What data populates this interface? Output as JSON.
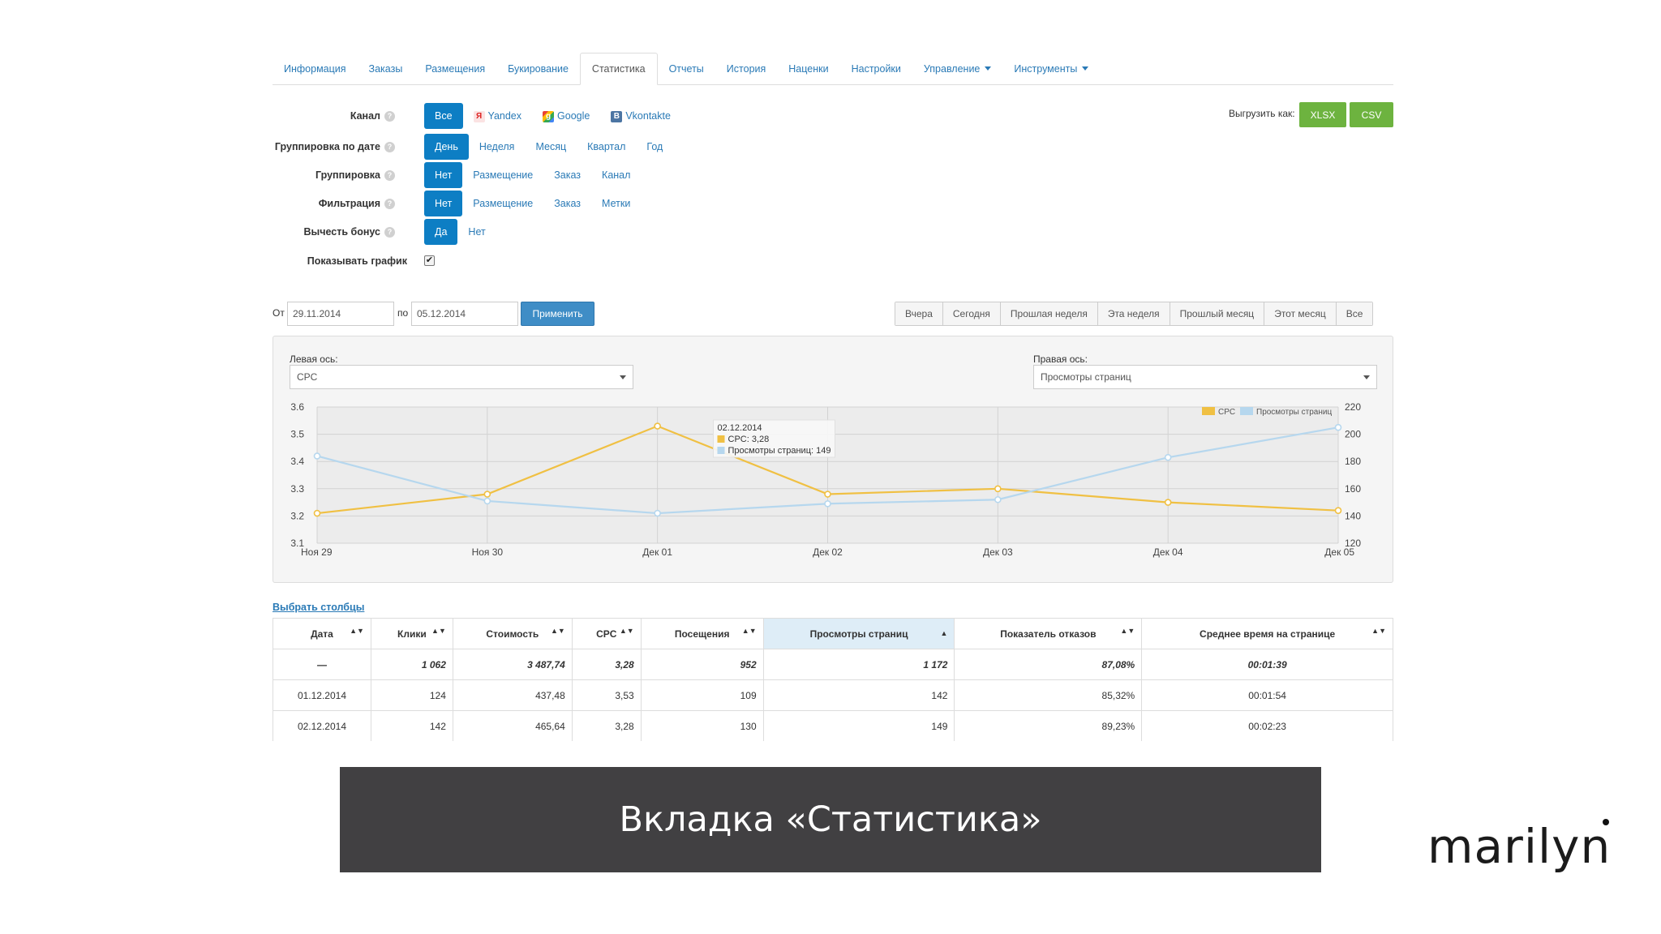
{
  "tabs": [
    {
      "label": "Информация"
    },
    {
      "label": "Заказы"
    },
    {
      "label": "Размещения"
    },
    {
      "label": "Букирование"
    },
    {
      "label": "Статистика",
      "active": true
    },
    {
      "label": "Отчеты"
    },
    {
      "label": "История"
    },
    {
      "label": "Наценки"
    },
    {
      "label": "Настройки"
    },
    {
      "label": "Управление",
      "dropdown": true
    },
    {
      "label": "Инструменты",
      "dropdown": true
    }
  ],
  "filters": {
    "channel": {
      "label": "Канал",
      "options": [
        "Все",
        "Yandex",
        "Google",
        "Vkontakte"
      ],
      "selected": "Все"
    },
    "date_grouping": {
      "label": "Группировка по дате",
      "options": [
        "День",
        "Неделя",
        "Месяц",
        "Квартал",
        "Год"
      ],
      "selected": "День"
    },
    "grouping": {
      "label": "Группировка",
      "options": [
        "Нет",
        "Размещение",
        "Заказ",
        "Канал"
      ],
      "selected": "Нет"
    },
    "filtering": {
      "label": "Фильтрация",
      "options": [
        "Нет",
        "Размещение",
        "Заказ",
        "Метки"
      ],
      "selected": "Нет"
    },
    "bonus": {
      "label": "Вычесть бонус",
      "options": [
        "Да",
        "Нет"
      ],
      "selected": "Да"
    },
    "show_chart": {
      "label": "Показывать график",
      "checked": true,
      "check_mark": "✔"
    }
  },
  "export": {
    "label": "Выгрузить как:",
    "xlsx": "XLSX",
    "csv": "CSV",
    "color": "#6db33f"
  },
  "daterange": {
    "from_label": "От",
    "from_value": "29.11.2014",
    "to_label": "по",
    "to_value": "05.12.2014",
    "apply": "Применить",
    "presets": [
      "Вчера",
      "Сегодня",
      "Прошлая неделя",
      "Эта неделя",
      "Прошлый месяц",
      "Этот месяц",
      "Все"
    ]
  },
  "chart_panel": {
    "left_axis_label": "Левая ось:",
    "left_axis_value": "CPC",
    "right_axis_label": "Правая ось:",
    "right_axis_value": "Просмотры страниц"
  },
  "chart_data": {
    "type": "line",
    "categories": [
      "Ноя 29",
      "Ноя 30",
      "Дек 01",
      "Дек 02",
      "Дек 03",
      "Дек 04",
      "Дек 05"
    ],
    "series": [
      {
        "name": "CPC",
        "axis": "left",
        "color": "#f0c043",
        "values": [
          3.21,
          3.28,
          3.53,
          3.28,
          3.3,
          3.25,
          3.22
        ]
      },
      {
        "name": "Просмотры страниц",
        "axis": "right",
        "color": "#b6d7ee",
        "values": [
          184,
          151,
          142,
          149,
          152,
          183,
          205
        ]
      }
    ],
    "left_axis": {
      "ticks": [
        "3.6",
        "3.5",
        "3.4",
        "3.3",
        "3.2",
        "3.1"
      ],
      "ylim": [
        3.1,
        3.6
      ]
    },
    "right_axis": {
      "ticks": [
        "220",
        "200",
        "180",
        "160",
        "140",
        "120"
      ],
      "ylim": [
        120,
        220
      ]
    },
    "legend": {
      "position": "top-right",
      "items": [
        "CPC",
        "Просмотры страниц"
      ]
    },
    "grid": true,
    "tooltip": {
      "date": "02.12.2014",
      "line1": "CPC: 3,28",
      "line2": "Просмотры страниц: 149",
      "category_index": 3
    }
  },
  "table": {
    "choose_columns": "Выбрать столбцы",
    "columns": [
      "Дата",
      "Клики",
      "Стоимость",
      "CPC",
      "Посещения",
      "Просмотры страниц",
      "Показатель отказов",
      "Среднее время на странице"
    ],
    "sorted_column": 5,
    "sort_both": "▲▼",
    "sort_asc": "▲",
    "total": [
      "—",
      "1 062",
      "3 487,74",
      "3,28",
      "952",
      "1 172",
      "87,08%",
      "00:01:39"
    ],
    "rows": [
      [
        "01.12.2014",
        "124",
        "437,48",
        "3,53",
        "109",
        "142",
        "85,32%",
        "00:01:54"
      ],
      [
        "02.12.2014",
        "142",
        "465,64",
        "3,28",
        "130",
        "149",
        "89,23%",
        "00:02:23"
      ]
    ]
  },
  "caption": "Вкладка «Статистика»",
  "logo": "marilyn"
}
